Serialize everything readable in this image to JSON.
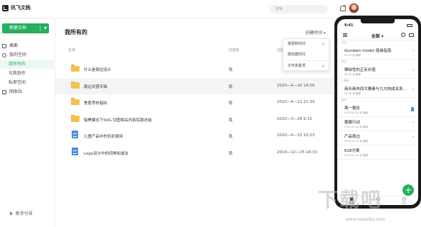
{
  "app": {
    "name": "讯飞文档"
  },
  "header": {
    "search_placeholder": "搜索"
  },
  "sidebar": {
    "new_button": "新建文档",
    "items": [
      {
        "label": "桌面",
        "level": "top",
        "icon": "monitor-icon"
      },
      {
        "label": "我的空间",
        "level": "top",
        "icon": "clock-icon"
      },
      {
        "label": "我所有的",
        "level": "sub",
        "active": true
      },
      {
        "label": "与我协作",
        "level": "sub"
      },
      {
        "label": "私密空间",
        "level": "sub"
      },
      {
        "label": "回收站",
        "level": "top",
        "icon": "trash-icon"
      }
    ],
    "guide": "新手引导"
  },
  "main": {
    "title": "我所有的",
    "sort_label": "创建时间",
    "columns": {
      "name": "名称",
      "creator": "创建者",
      "time": "创建时间"
    },
    "rows": [
      {
        "type": "folder",
        "name": "什么是周边设计",
        "creator": "我",
        "time": ""
      },
      {
        "type": "folder",
        "name": "周边灵感专辑",
        "creator": "我",
        "time": "2020—4—20 14:56",
        "selected": true
      },
      {
        "type": "folder",
        "name": "季度考核指标",
        "creator": "我",
        "time": "2020—4—12 21:34"
      },
      {
        "type": "folder",
        "name": "暗黑模式下SVG 切图相关内容实践总结",
        "creator": "我",
        "time": "2020—3—28 9:12"
      },
      {
        "type": "doc",
        "name": "儿童产品中的色彩使用",
        "creator": "我",
        "time": "2020—4—15 10:23"
      },
      {
        "type": "doc",
        "name": "Logo设计中的四种加减法",
        "creator": "我",
        "time": "2019—12—25 18:33"
      }
    ],
    "sort_menu": [
      {
        "label": "按更新时间",
        "checked": true
      },
      {
        "label": "按创建时间",
        "checked": false
      },
      {
        "label": "文件夹置顶",
        "checked": true
      }
    ]
  },
  "phone": {
    "time": "9:41",
    "header_title": "全部",
    "sections": [
      {
        "label": "今天",
        "items": [
          {
            "title": "Gundam model 组装指南",
            "sub": "04-29  我  编辑",
            "icon": "more"
          }
        ]
      },
      {
        "label": "昨天",
        "items": [
          {
            "title": "稀缺性的正反价值",
            "sub": "04-28  我  编辑",
            "icon": "more"
          }
        ]
      },
      {
        "label": "一周内",
        "items": [
          {
            "title": "商业画布四大要素与九大构成关系…",
            "sub": "04-26  我  编辑",
            "icon": "more"
          }
        ]
      },
      {
        "label": "更早",
        "items": [
          {
            "title": "周一报告",
            "sub": "2020-04-20  我  编辑",
            "icon": "doc"
          },
          {
            "title": "展展行动",
            "sub": "2020-04-18  我  编辑",
            "icon": "more"
          },
          {
            "title": "产品周边",
            "sub": "2020-04-15  我  编辑",
            "icon": "more"
          },
          {
            "title": "618方案",
            "sub": "2020-04-10  我  编辑",
            "icon": "more"
          }
        ]
      }
    ],
    "tabs": [
      "桌面",
      "协作",
      "我的"
    ],
    "fab": "+"
  },
  "watermark": {
    "text": "下载吧",
    "url": "www.xiazaiba.com"
  }
}
